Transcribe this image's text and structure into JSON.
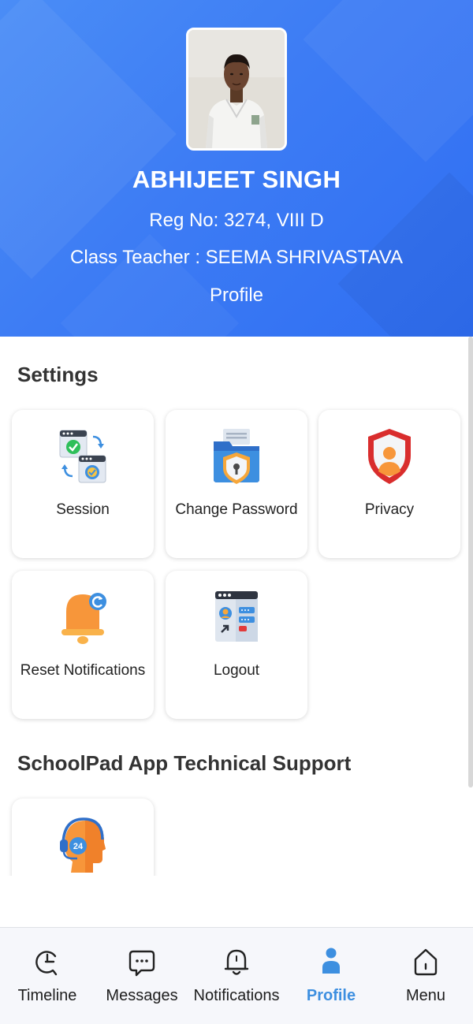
{
  "profile": {
    "name": "ABHIJEET SINGH",
    "reg_line": "Reg No: 3274, VIII D",
    "teacher_line": "Class Teacher : SEEMA SHRIVASTAVA",
    "caption": "Profile"
  },
  "settings": {
    "title": "Settings",
    "items": [
      {
        "label": "Session",
        "icon": "session-sync-icon"
      },
      {
        "label": "Change Password",
        "icon": "password-folder-icon"
      },
      {
        "label": "Privacy",
        "icon": "privacy-shield-icon"
      },
      {
        "label": "Reset Notifications",
        "icon": "bell-reset-icon"
      },
      {
        "label": "Logout",
        "icon": "logout-window-icon"
      }
    ]
  },
  "support": {
    "title": "SchoolPad App Technical Support",
    "items": [
      {
        "label": "",
        "icon": "support-24-headset-icon",
        "badge": "24"
      }
    ]
  },
  "nav": {
    "items": [
      {
        "label": "Timeline",
        "icon": "timeline-icon"
      },
      {
        "label": "Messages",
        "icon": "message-bubble-icon"
      },
      {
        "label": "Notifications",
        "icon": "bell-icon"
      },
      {
        "label": "Profile",
        "icon": "person-icon"
      },
      {
        "label": "Menu",
        "icon": "home-icon"
      }
    ],
    "active": "Profile"
  },
  "colors": {
    "header_blue": "#3d7cf4",
    "active_nav": "#3d8fe0",
    "privacy_red": "#d92d2d",
    "bell_orange": "#f7963a"
  }
}
